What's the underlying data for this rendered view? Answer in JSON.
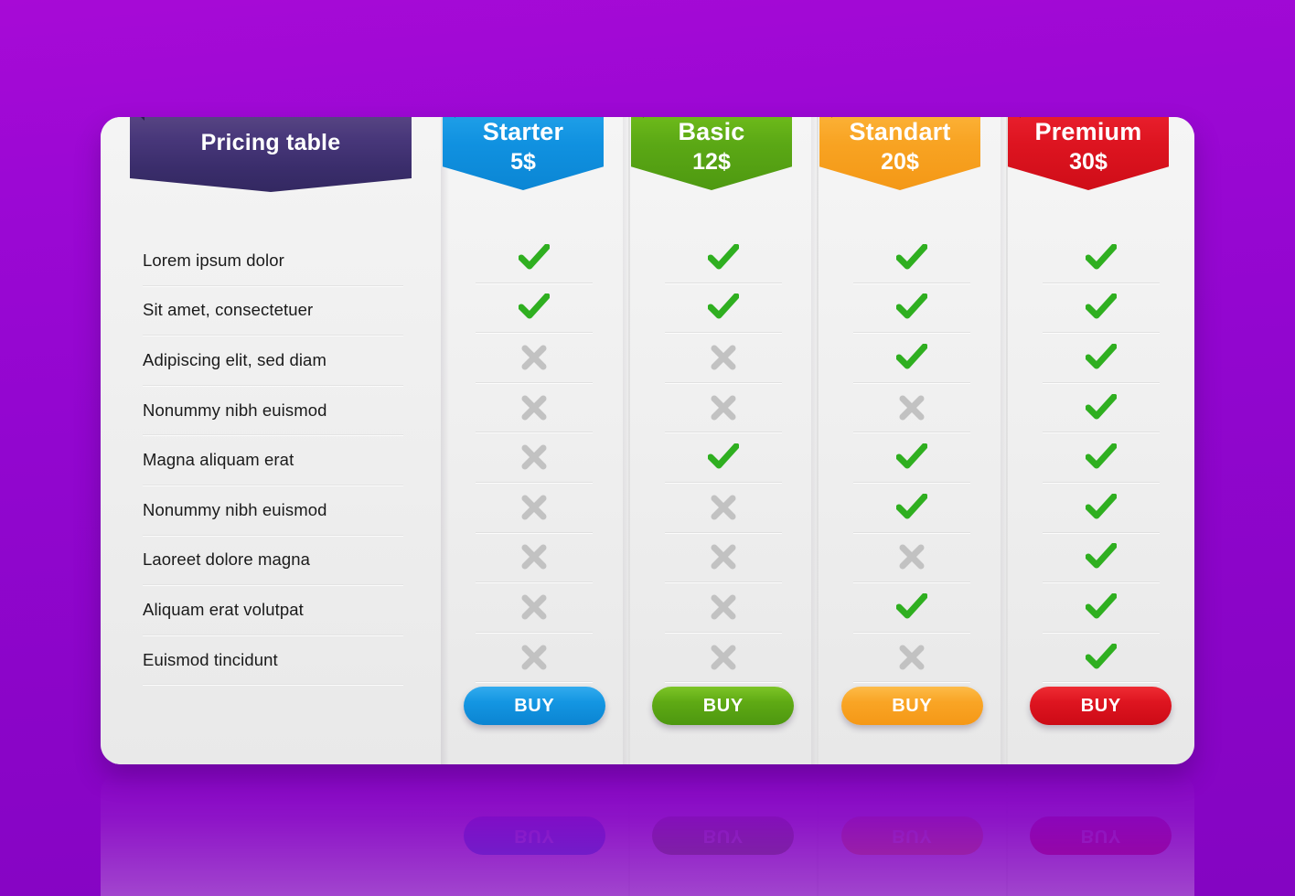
{
  "background": {
    "color_top": "#a70ad6",
    "color_bottom": "#8405c2"
  },
  "title_ribbon": {
    "label": "Pricing table",
    "color": "#3a2d6b"
  },
  "features": [
    "Lorem ipsum dolor",
    "Sit amet, consectetuer",
    "Adipiscing elit, sed diam",
    "Nonummy nibh euismod",
    "Magna aliquam erat",
    "Nonummy nibh euismod",
    "Laoreet dolore magna",
    "Aliquam erat volutpat",
    "Euismod tincidunt"
  ],
  "plans": [
    {
      "name": "Starter",
      "price": "5$",
      "color": "#1091e0",
      "buy_label": "BUY",
      "marks": [
        "check",
        "check",
        "cross",
        "cross",
        "cross",
        "cross",
        "cross",
        "cross",
        "cross"
      ]
    },
    {
      "name": "Basic",
      "price": "12$",
      "color": "#5ba815",
      "buy_label": "BUY",
      "marks": [
        "check",
        "check",
        "cross",
        "cross",
        "check",
        "cross",
        "cross",
        "cross",
        "cross"
      ]
    },
    {
      "name": "Standart",
      "price": "20$",
      "color": "#f8a322",
      "buy_label": "BUY",
      "marks": [
        "check",
        "check",
        "check",
        "cross",
        "check",
        "check",
        "cross",
        "check",
        "cross"
      ]
    },
    {
      "name": "Premium",
      "price": "30$",
      "color": "#dd1420",
      "buy_label": "BUY",
      "marks": [
        "check",
        "check",
        "check",
        "check",
        "check",
        "check",
        "check",
        "check",
        "check"
      ]
    }
  ],
  "mark_colors": {
    "check": "#2faf20",
    "cross": "#c2c2c2"
  }
}
